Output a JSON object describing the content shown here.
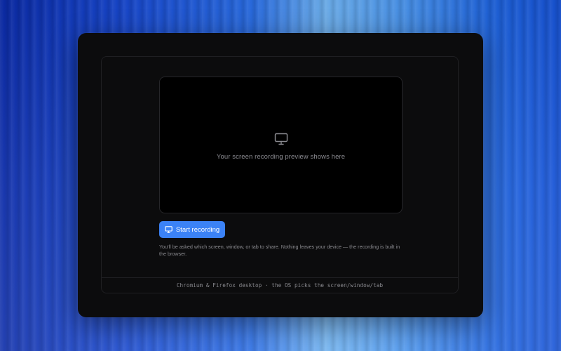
{
  "preview": {
    "icon": "monitor-icon",
    "placeholder_text": "Your screen recording preview shows here"
  },
  "actions": {
    "start_recording_label": "Start recording",
    "start_recording_icon": "monitor-icon"
  },
  "help_text": "You'll be asked which screen, window, or tab to share. Nothing leaves your device — the recording is built in the browser.",
  "footer_text": "Chromium & Firefox desktop · the OS picks the screen/window/tab",
  "colors": {
    "accent": "#3b82f6",
    "window_bg": "#0c0c0d",
    "preview_bg": "#000000"
  }
}
